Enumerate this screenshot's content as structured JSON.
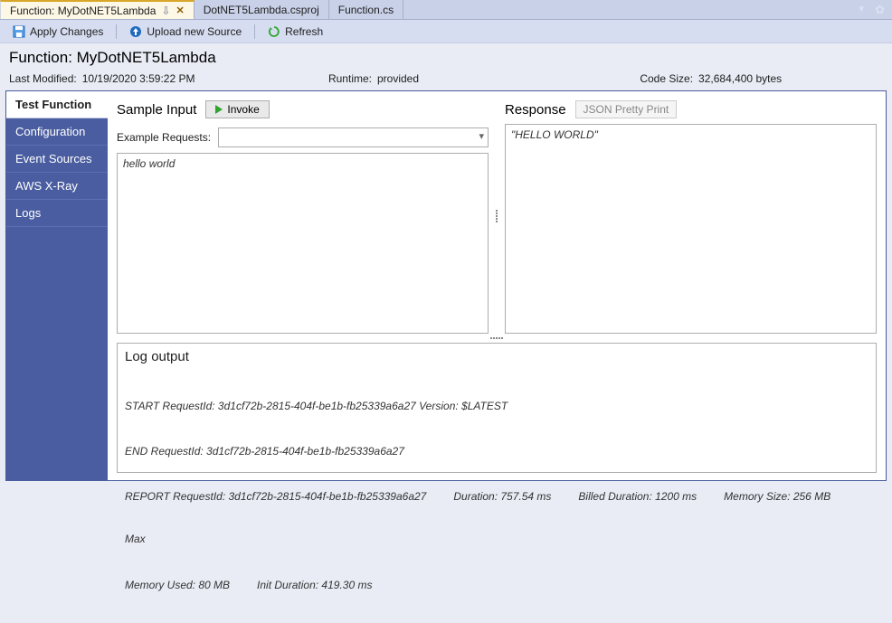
{
  "tabs": [
    {
      "label": "Function: MyDotNET5Lambda",
      "active": true,
      "pinned": true,
      "closable": true
    },
    {
      "label": "DotNET5Lambda.csproj",
      "active": false
    },
    {
      "label": "Function.cs",
      "active": false
    }
  ],
  "toolbar": {
    "apply": "Apply Changes",
    "upload": "Upload new Source",
    "refresh": "Refresh"
  },
  "header": {
    "title": "Function: MyDotNET5Lambda",
    "last_modified_label": "Last Modified:",
    "last_modified": "10/19/2020 3:59:22 PM",
    "runtime_label": "Runtime:",
    "runtime": "provided",
    "code_size_label": "Code Size:",
    "code_size": "32,684,400 bytes"
  },
  "sidebar": {
    "items": [
      {
        "label": "Test Function",
        "active": true
      },
      {
        "label": "Configuration"
      },
      {
        "label": "Event Sources"
      },
      {
        "label": "AWS X-Ray"
      },
      {
        "label": "Logs"
      }
    ]
  },
  "test": {
    "sample_input_heading": "Sample Input",
    "invoke_label": "Invoke",
    "example_requests_label": "Example Requests:",
    "example_requests_value": "",
    "input_text": "hello world",
    "response_heading": "Response",
    "json_pretty_label": "JSON Pretty Print",
    "response_text": "\"HELLO WORLD\""
  },
  "log": {
    "heading": "Log output",
    "lines": [
      "START RequestId: 3d1cf72b-2815-404f-be1b-fb25339a6a27 Version: $LATEST",
      "END RequestId: 3d1cf72b-2815-404f-be1b-fb25339a6a27"
    ],
    "report_parts": {
      "prefix": "REPORT RequestId: 3d1cf72b-2815-404f-be1b-fb25339a6a27",
      "duration": "Duration: 757.54 ms",
      "billed": "Billed Duration: 1200 ms",
      "mem_size": "Memory Size: 256 MB",
      "max": "Max"
    },
    "trail_parts": {
      "mem_used": "Memory Used: 80 MB",
      "init": "Init Duration: 419.30 ms"
    }
  }
}
